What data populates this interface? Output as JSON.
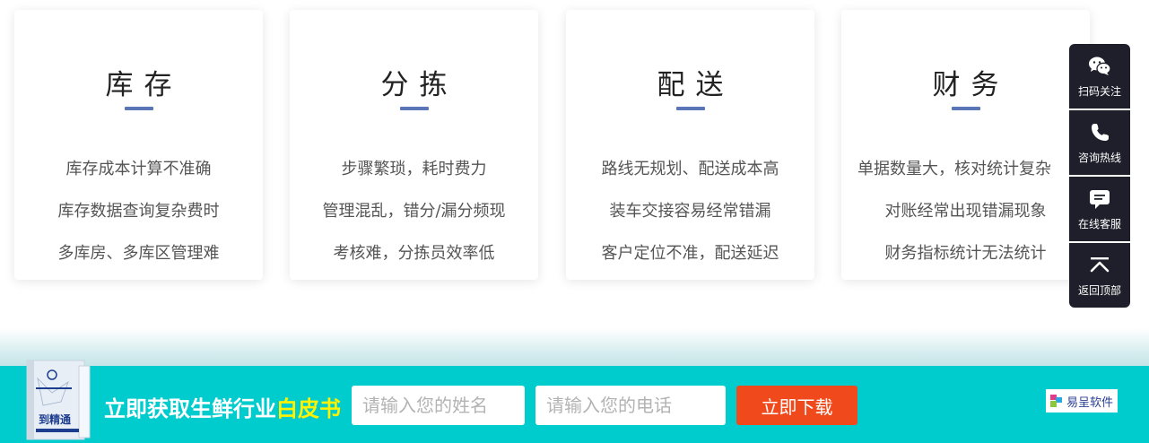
{
  "cards": [
    {
      "title": "库存",
      "lines": [
        "库存成本计算不准确",
        "库存数据查询复杂费时",
        "多库房、多库区管理难"
      ]
    },
    {
      "title": "分拣",
      "lines": [
        "步骤繁琐，耗时费力",
        "管理混乱，错分/漏分频现",
        "考核难，分拣员效率低"
      ]
    },
    {
      "title": "配送",
      "lines": [
        "路线无规划、配送成本高",
        "装车交接容易经常错漏",
        "客户定位不准，配送延迟"
      ]
    },
    {
      "title": "财务",
      "lines": [
        "单据数量大，核对统计复杂",
        "对账经常出现错漏现象",
        "财务指标统计无法统计"
      ]
    }
  ],
  "side_toolbar": {
    "items": [
      {
        "label": "扫码关注",
        "icon": "wechat-icon"
      },
      {
        "label": "咨询热线",
        "icon": "phone-icon"
      },
      {
        "label": "在线客服",
        "icon": "chat-icon"
      },
      {
        "label": "返回顶部",
        "icon": "back-to-top-icon"
      }
    ]
  },
  "banner": {
    "headline_prefix": "立即获取生鲜行业",
    "headline_highlight": "白皮书",
    "name_placeholder": "请输入您的姓名",
    "phone_placeholder": "请输入您的电话",
    "download_label": "立即下载",
    "book_title": "到精通",
    "logo_text": "易呈软件"
  },
  "colors": {
    "accent_bar": "#5a76b8",
    "toolbar_bg": "#1e1f2a",
    "banner_bg": "#00cccd",
    "highlight": "#fff200",
    "button_bg": "#f04a1c"
  }
}
